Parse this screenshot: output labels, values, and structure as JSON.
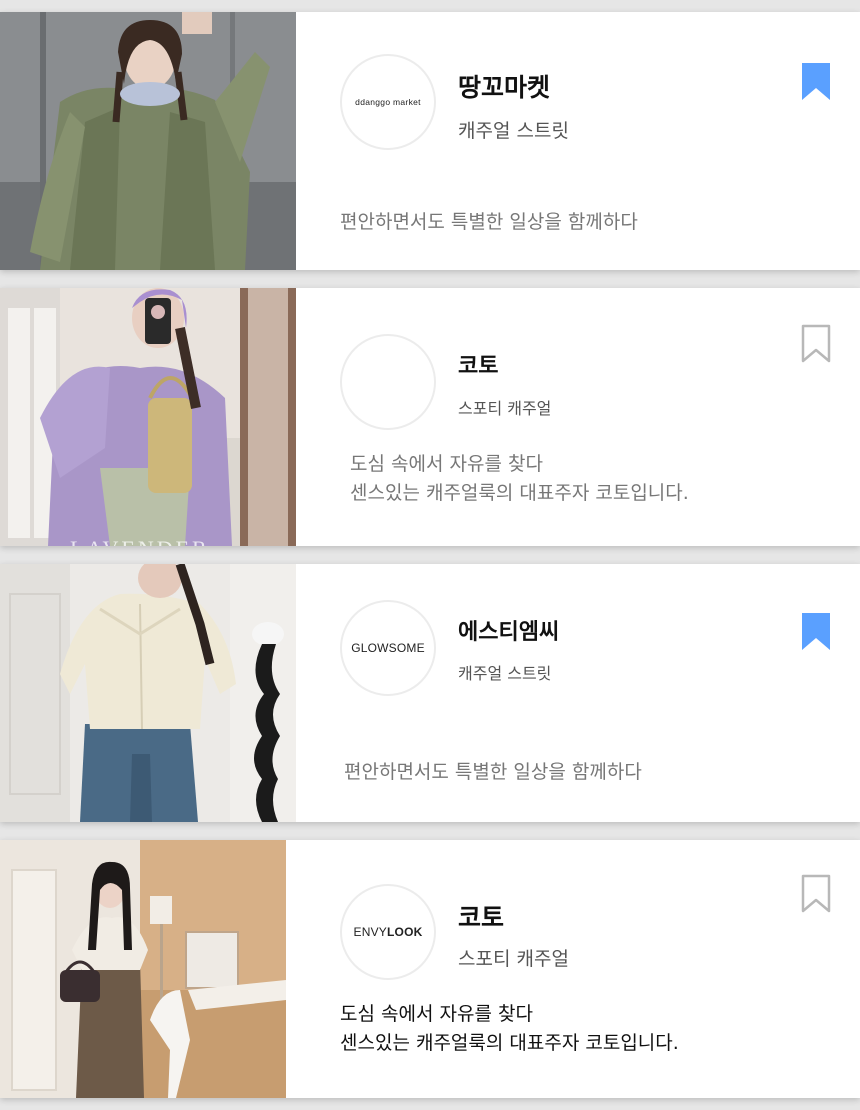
{
  "cards": [
    {
      "logo_text": "ddanggo market",
      "name": "땅꼬마켓",
      "style": "캐주얼 스트릿",
      "desc_lines": [
        "편안하면서도 특별한 일상을 함께하다"
      ],
      "bookmarked": true
    },
    {
      "logo_text": "",
      "name": "코토",
      "style": "스포티 캐주얼",
      "desc_lines": [
        "도심 속에서 자유를 찾다",
        "센스있는 캐주얼룩의 대표주자 코토입니다."
      ],
      "bookmarked": false,
      "photo_watermark": "LAVENDER"
    },
    {
      "logo_text": "GLOWSOME",
      "name": "에스티엠씨",
      "style": "캐주얼 스트릿",
      "desc_lines": [
        "편안하면서도 특별한 일상을 함께하다"
      ],
      "bookmarked": true
    },
    {
      "logo_text": "ENVYLOOK",
      "name": "코토",
      "style": "스포티 캐주얼",
      "desc_lines": [
        "도심 속에서 자유를 찾다",
        "센스있는 캐주얼룩의 대표주자 코토입니다."
      ],
      "bookmarked": false
    }
  ],
  "colors": {
    "bookmark_active": "#5aa0ff",
    "bookmark_inactive": "#b8b8b8"
  },
  "icons": {
    "bookmark_active": "bookmark-filled-icon",
    "bookmark_inactive": "bookmark-outline-icon"
  }
}
